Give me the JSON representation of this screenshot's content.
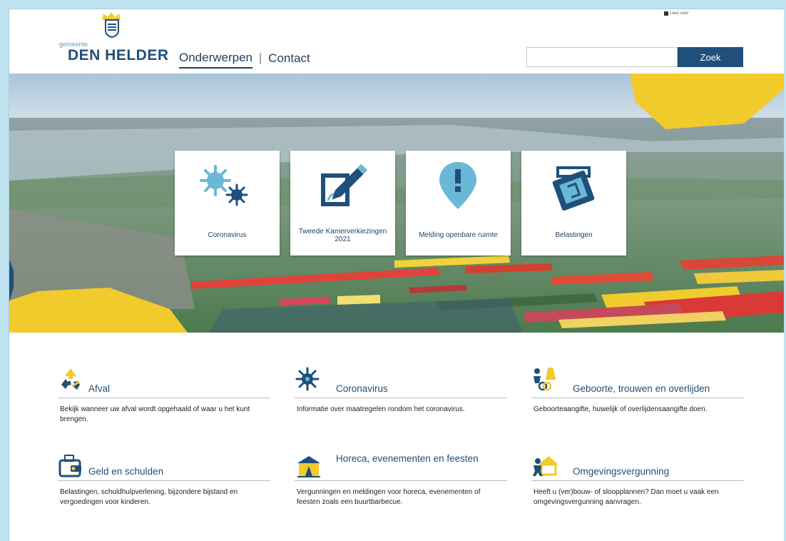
{
  "header": {
    "gemeente": "gemeente",
    "brand": "DEN HELDER",
    "nav": [
      {
        "label": "Onderwerpen"
      },
      {
        "label": "Contact"
      }
    ],
    "nav_separator": "|",
    "readspeaker": "Lees voor",
    "search": {
      "placeholder": "",
      "button": "Zoek"
    }
  },
  "tiles": [
    {
      "label": "Coronavirus",
      "icon": "virus-icon"
    },
    {
      "label": "Tweede Kamerverkiezingen 2021",
      "icon": "ballot-pencil-icon"
    },
    {
      "label": "Melding openbare ruimte",
      "icon": "map-pin-exclamation-icon"
    },
    {
      "label": "Belastingen",
      "icon": "payment-card-icon"
    }
  ],
  "categories": [
    {
      "title": "Afval",
      "description": "Bekijk wanneer uw afval wordt opgehaald of waar u het kunt brengen.",
      "icon": "recycle-icon"
    },
    {
      "title": "Coronavirus",
      "description": "Informatie over maatregelen rondom het coronavirus.",
      "icon": "virus-icon"
    },
    {
      "title": "Geboorte, trouwen en overlijden",
      "description": "Geboorteaangifte, huwelijk of overlijdensaangifte doen.",
      "icon": "family-icon"
    },
    {
      "title": "Geld en schulden",
      "description": "Belastingen, schuldhulpverlening, bijzondere bijstand en vergoedingen voor kinderen.",
      "icon": "wallet-icon"
    },
    {
      "title": "Horeca, evenementen en feesten",
      "description": "Vergunningen en meldingen voor horeca, evenementen of feesten zoals een buurtbarbecue.",
      "icon": "tent-icon"
    },
    {
      "title": "Omgevingsvergunning",
      "description": "Heeft u (ver)bouw- of sloopplannen? Dan moet u vaak een omgevingsvergunning aanvragen.",
      "icon": "house-worker-icon"
    }
  ],
  "colors": {
    "navy": "#1f4f7a",
    "light_blue": "#6bb7d6",
    "yellow": "#f1cb2c",
    "frame": "#bfe3ef"
  }
}
